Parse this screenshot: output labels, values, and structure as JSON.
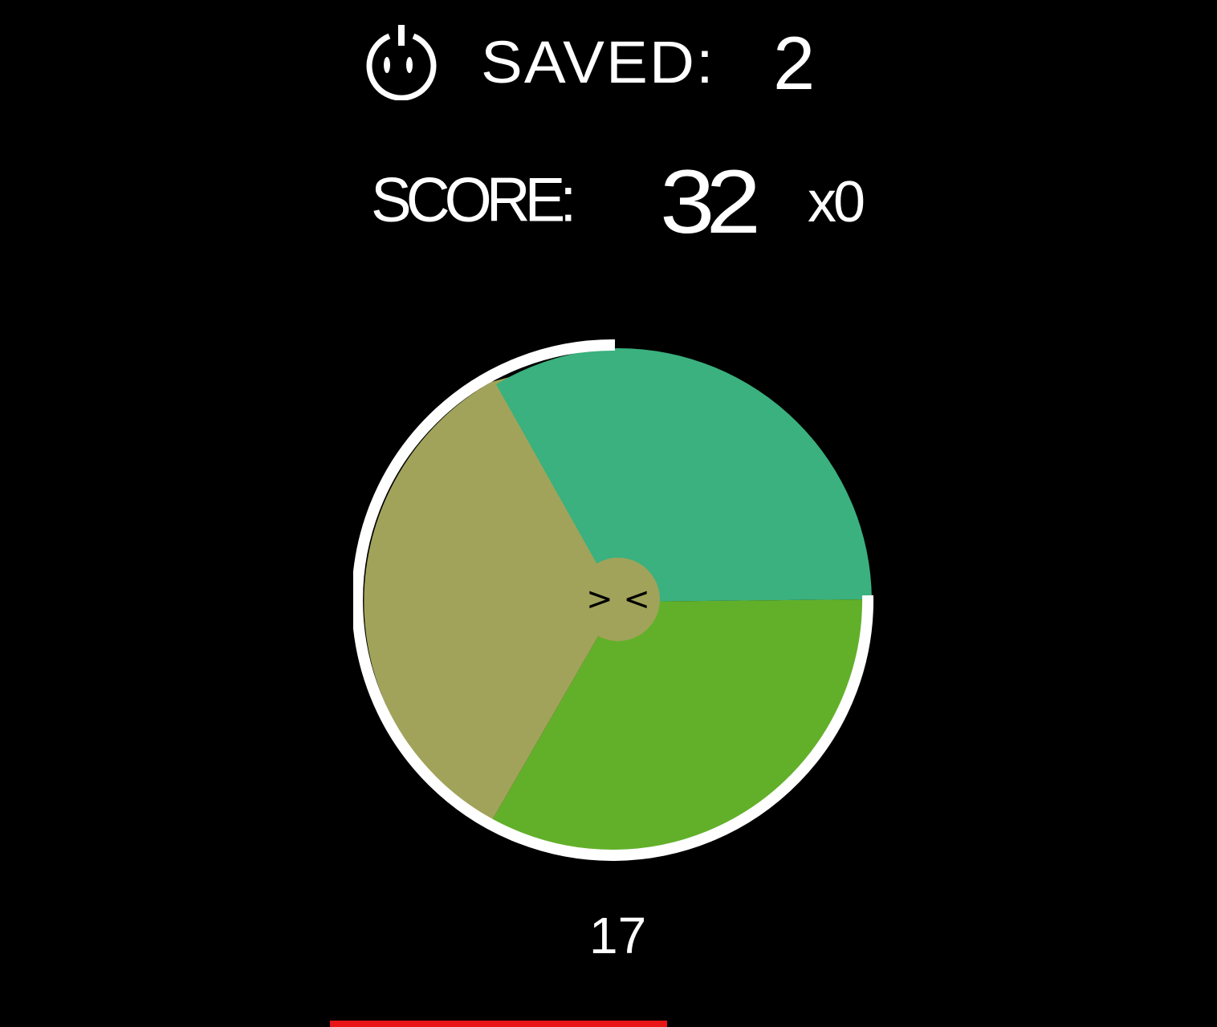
{
  "header": {
    "power_icon": "power-icon",
    "saved_label": "SAVED:",
    "saved_value": "2"
  },
  "score": {
    "label": "SCORE:",
    "value": "32",
    "multiplier": "x0"
  },
  "wheel": {
    "segments": [
      {
        "name": "teal",
        "color": "#3ab17e"
      },
      {
        "name": "green",
        "color": "#62b02a"
      },
      {
        "name": "olive",
        "color": "#a1a35a"
      }
    ],
    "center_color": "#a1a35a",
    "face": "> <",
    "ring_color": "#ffffff"
  },
  "timer": {
    "value": "17"
  },
  "progress": {
    "fraction": 0.6,
    "color": "#e81416"
  }
}
